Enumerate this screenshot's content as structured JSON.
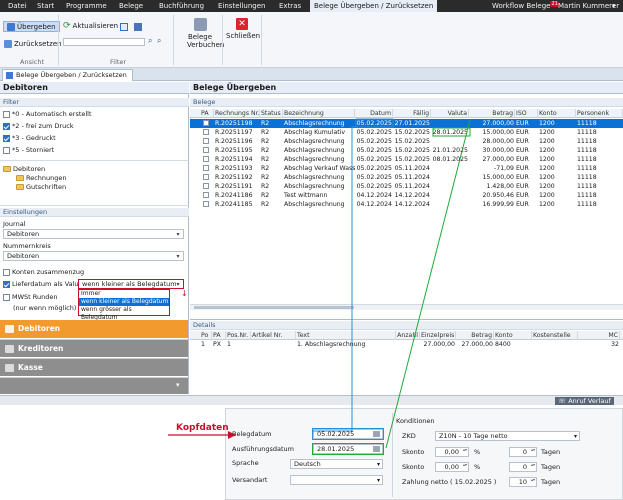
{
  "menubar": {
    "items": [
      "Datei",
      "Start",
      "Programme",
      "Belege",
      "Buchführung",
      "Einstellungen",
      "Extras",
      "Belege Übergeben / Zurücksetzen"
    ],
    "workflow": "Workflow Belege",
    "workflow_badge": "21",
    "user": "Martin Kummerer"
  },
  "ribbon": {
    "btn_uebergeben": "Übergeben",
    "btn_zuruecksetzen": "Zurücksetzen",
    "group_ansicht": "Ansicht",
    "btn_aktualisieren": "Aktualisieren",
    "group_filter": "Filter",
    "btn_verbuchen_1": "Belege",
    "btn_verbuchen_2": "Verbuchen",
    "btn_schliessen": "Schließen"
  },
  "tab": {
    "label": "Belege Übergeben / Zurücksetzen"
  },
  "left": {
    "title": "Debitoren",
    "filter_header": "Filter",
    "filters": [
      {
        "label": "*0 - Automatisch erstellt",
        "checked": false
      },
      {
        "label": "*2 - frei zum Druck",
        "checked": true
      },
      {
        "label": "*3 - Gedruckt",
        "checked": true
      },
      {
        "label": "*5 - Storniert",
        "checked": false
      }
    ],
    "tree": {
      "root": "Debitoren",
      "children": [
        "Rechnungen",
        "Gutschriften"
      ]
    },
    "settings_header": "Einstellungen",
    "journal_label": "Journal",
    "journal_value": "Debitoren",
    "nummernkreis_label": "Nummernkreis",
    "nummernkreis_value": "Debitoren",
    "konten_label": "Konten zusammenzug",
    "lieferdatum_label": "Lieferdatum als Valuta",
    "lieferdatum_value": "wenn kleiner als Belegdatum",
    "dropdown_options": [
      "Immer",
      "wenn kleiner als Belegdatum",
      "wenn grösser als Belegdatum"
    ],
    "mwst_label": "MWSt Runden",
    "mwst_sub": "(nur wenn möglich)",
    "nav": [
      "Debitoren",
      "Kreditoren",
      "Kasse"
    ]
  },
  "belege": {
    "title": "Belege Übergeben",
    "section": "Belege",
    "columns": [
      "PA",
      "Rechnungs Nr.",
      "Status",
      "Bezeichnung",
      "Datum",
      "Fällig",
      "Valuta",
      "Betrag",
      "ISO",
      "Konto",
      "Personenk"
    ],
    "rows": [
      [
        "R.20251198",
        "R2",
        "Abschlagsrechnung",
        "05.02.2025",
        "27.01.2025",
        "",
        "27.000,00",
        "EUR",
        "1200",
        "11118"
      ],
      [
        "R.20251197",
        "R2",
        "Abschlag Kumulativ",
        "05.02.2025",
        "15.02.2025",
        "28.01.2025",
        "15.000,00",
        "EUR",
        "1200",
        "11118"
      ],
      [
        "R.20251196",
        "R2",
        "Abschlagsrechnung",
        "05.02.2025",
        "15.02.2025",
        "",
        "28.000,00",
        "EUR",
        "1200",
        "11118"
      ],
      [
        "R.20251195",
        "R2",
        "Abschlagsrechnung",
        "05.02.2025",
        "15.02.2025",
        "21.01.2025",
        "30.000,00",
        "EUR",
        "1200",
        "11118"
      ],
      [
        "R.20251194",
        "R2",
        "Abschlagsrechnung",
        "05.02.2025",
        "15.02.2025",
        "08.01.2025",
        "27.000,00",
        "EUR",
        "1200",
        "11118"
      ],
      [
        "R.20251193",
        "R2",
        "Abschlag Verkauf Wasse",
        "05.02.2025",
        "05.11.2024",
        "",
        "-71,09",
        "EUR",
        "1200",
        "11118"
      ],
      [
        "R.20251192",
        "R2",
        "Abschlagsrechnung",
        "05.02.2025",
        "05.11.2024",
        "",
        "15.000,00",
        "EUR",
        "1200",
        "11118"
      ],
      [
        "R.20251191",
        "R2",
        "Abschlagsrechnung",
        "05.02.2025",
        "05.11.2024",
        "",
        "1.428,00",
        "EUR",
        "1200",
        "11118"
      ],
      [
        "R.20241186",
        "R2",
        "Test wittmann",
        "04.12.2024",
        "14.12.2024",
        "",
        "20.950,46",
        "EUR",
        "1200",
        "11118"
      ],
      [
        "R.20241185",
        "R2",
        "Abschlagsrechnung",
        "04.12.2024",
        "14.12.2024",
        "",
        "16.999,99",
        "EUR",
        "1200",
        "11118"
      ]
    ]
  },
  "details": {
    "section": "Details",
    "columns": [
      "Po",
      "PA",
      "Pos.Nr.",
      "Artikel Nr.",
      "Text",
      "Anzahl",
      "Einzelpreis",
      "Betrag",
      "Konto",
      "Kostenstelle",
      "MC"
    ],
    "row": [
      "1",
      "PX",
      "1",
      "",
      "1. Abschlagsrechnung",
      "",
      "27.000,00",
      "27.000,00",
      "8400",
      "",
      "32"
    ]
  },
  "statusbar": {
    "anruf": "Anruf Verlauf"
  },
  "kopf": {
    "callout": "Kopfdaten",
    "belegdatum_label": "Belegdatum",
    "belegdatum_value": "05.02.2025",
    "ausfuehrung_label": "Ausführungsdatum",
    "ausfuehrung_value": "28.01.2025",
    "sprache_label": "Sprache",
    "sprache_value": "Deutsch",
    "versandart_label": "Versandart",
    "konditionen_label": "Konditionen",
    "zkd_label": "ZKD",
    "zkd_value": "Z10N  -  10 Tage netto",
    "skonto_label": "Skonto",
    "skonto1_pct": "0,00",
    "skonto1_days": "0",
    "skonto2_pct": "0,00",
    "skonto2_days": "0",
    "zahlung_label": "Zahlung netto  ( 15.02.2025 )",
    "zahlung_days": "10",
    "pct": "%",
    "tage": "Tagen"
  },
  "colors": {
    "accent": "#0a72d6",
    "nav_active": "#f29a2e",
    "callout": "#c8102e",
    "line_blue": "#2a8fd6",
    "line_green": "#21a93a"
  }
}
